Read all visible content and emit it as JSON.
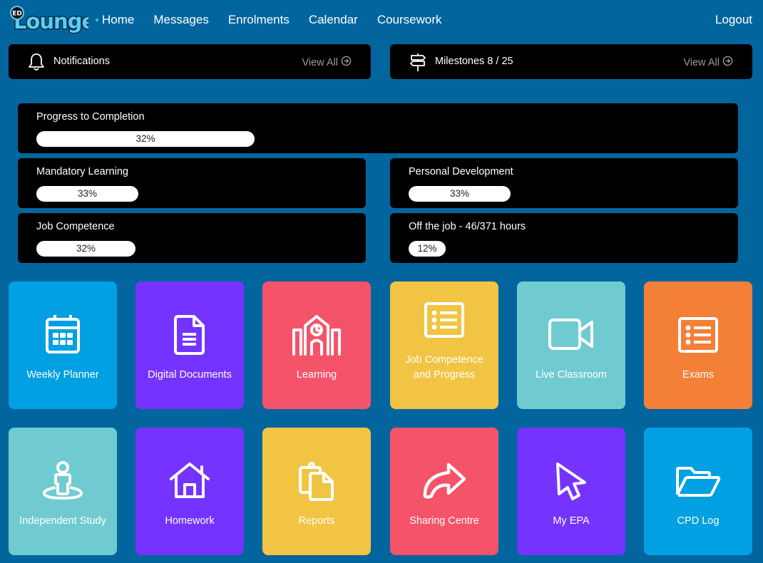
{
  "header": {
    "logo_small": "ED",
    "logo_text": "Lounge",
    "nav": [
      {
        "label": "Home",
        "active": true
      },
      {
        "label": "Messages",
        "active": false
      },
      {
        "label": "Enrolments",
        "active": false
      },
      {
        "label": "Calendar",
        "active": false
      },
      {
        "label": "Coursework",
        "active": false
      }
    ],
    "logout": "Logout"
  },
  "panels": {
    "notifications": {
      "title": "Notifications",
      "link": "View All",
      "icon": "bell-icon"
    },
    "milestones": {
      "title": "Milestones 8 / 25",
      "link": "View All",
      "icon": "signpost-icon"
    }
  },
  "progress": {
    "completion": {
      "title": "Progress to Completion",
      "value": 32,
      "label": "32%"
    },
    "mandatory": {
      "title": "Mandatory Learning",
      "value": 33,
      "label": "33%"
    },
    "personal": {
      "title": "Personal Development",
      "value": 33,
      "label": "33%"
    },
    "job": {
      "title": "Job Competence",
      "value": 32,
      "label": "32%"
    },
    "offjob": {
      "title": "Off the job - 46/371 hours",
      "value": 12,
      "label": "12%"
    }
  },
  "colors": {
    "background": "#03659e",
    "blue": "#00a0e3",
    "purple": "#7433ff",
    "red": "#f5536a",
    "yellow": "#f2c443",
    "teal": "#70cbd0",
    "orange": "#f48037"
  },
  "tiles": [
    {
      "label": "Weekly Planner",
      "icon": "calendar-icon",
      "color": "#00a0e3"
    },
    {
      "label": "Digital Documents",
      "icon": "document-icon",
      "color": "#7433ff"
    },
    {
      "label": "Learning",
      "icon": "school-icon",
      "color": "#f5536a"
    },
    {
      "label": "Job Competence and Progress",
      "line1": "Job Competence",
      "line2": "and Progress",
      "icon": "list-icon",
      "color": "#f2c443"
    },
    {
      "label": "Live Classroom",
      "icon": "video-camera-icon",
      "color": "#70cbd0"
    },
    {
      "label": "Exams",
      "icon": "list-icon",
      "color": "#f48037"
    },
    {
      "label": "Independent Study",
      "icon": "person-icon",
      "color": "#70cbd0"
    },
    {
      "label": "Homework",
      "icon": "house-icon",
      "color": "#7433ff"
    },
    {
      "label": "Reports",
      "icon": "clipboard-copy-icon",
      "color": "#f2c443"
    },
    {
      "label": "Sharing Centre",
      "icon": "share-arrow-icon",
      "color": "#f5536a"
    },
    {
      "label": "My EPA",
      "icon": "cursor-pointer-icon",
      "color": "#7433ff"
    },
    {
      "label": "CPD Log",
      "icon": "folder-open-icon",
      "color": "#00a0e3"
    }
  ]
}
